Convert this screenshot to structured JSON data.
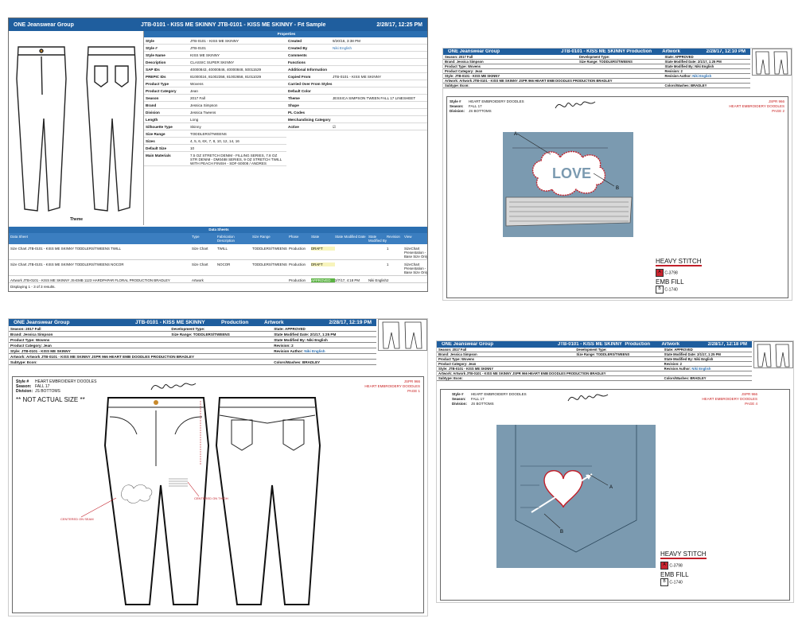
{
  "colors": {
    "header": "#1f5e9e",
    "swatch_a": "#c9252f",
    "denim": "#7b9ab0",
    "stitch": "#c2202a"
  },
  "p1": {
    "title_left": "ONE Jeanswear Group",
    "title_mid": "JTB-0101 - KISS ME SKINNY  JTB-0101 - KISS ME SKINNY - Fit Sample -",
    "title_right": "2/28/17, 12:25 PM",
    "image_caption": "Theme",
    "props_title": "Properties",
    "left": [
      {
        "k": "Style",
        "v": "JTB-0101 - KISS ME SKINNY"
      },
      {
        "k": "Style #",
        "v": "JTB-0101"
      },
      {
        "k": "Style Name",
        "v": "KISS ME SKINNY"
      },
      {
        "k": "Description",
        "v": "CLASSIC SUPER SKINNY"
      },
      {
        "k": "SAP IDs",
        "v": "40000843, 40000846, 40000848, 50011529"
      },
      {
        "k": "PREPIC IDs",
        "v": "81000024, 81002358, 81002658, 81011029"
      },
      {
        "k": "Product Type",
        "v": "Wovens"
      },
      {
        "k": "Product Category",
        "v": "Jean"
      },
      {
        "k": "Season",
        "v": "2017 Fall"
      },
      {
        "k": "Brand",
        "v": "Jessica Simpson"
      },
      {
        "k": "Division",
        "v": "Jessica Tweens"
      },
      {
        "k": "Length",
        "v": "Long"
      },
      {
        "k": "Silhouette Type",
        "v": "Skinny"
      },
      {
        "k": "Size Range",
        "v": "TODDLERS/TWEENS"
      },
      {
        "k": "Sizes",
        "v": "4, 5, 6, 6X, 7, 8, 10, 12, 14, 16"
      },
      {
        "k": "Default Size",
        "v": "10"
      },
      {
        "k": "Main Materials",
        "v": "7.5 OZ STRETCH DENIM - FILLING SERIES, 7.8 OZ STR DENIM - DM0488 SERIES, 9 OZ STRETCH TWILL WITH PEACH FINISH - SDF-S0008 / ANDRES"
      }
    ],
    "right": [
      {
        "k": "Created",
        "v": "9/20/16, 3:38 PM"
      },
      {
        "k": "Created By",
        "v": "Niki English"
      },
      {
        "k": "Comments",
        "v": ""
      },
      {
        "k": "Functions",
        "v": ""
      },
      {
        "k": "Additional Information",
        "v": ""
      },
      {
        "k": "Copied From",
        "v": "JTB-0101 - KISS ME SKINNY"
      },
      {
        "k": "Carried Over From Styles",
        "v": ""
      },
      {
        "k": "Default Color",
        "v": ""
      },
      {
        "k": "Theme",
        "v": "JESSICA SIMPSON TWEEN FALL 17 LINESHEET"
      },
      {
        "k": "Shape",
        "v": ""
      },
      {
        "k": "PL Codes",
        "v": ""
      },
      {
        "k": "Merchandising Category",
        "v": ""
      },
      {
        "k": "Active",
        "v": "☑"
      }
    ],
    "de_title": "Data Sheets",
    "de_headers": [
      "Data Sheet",
      "Type",
      "Fabrication Description",
      "Size Range",
      "Phase",
      "State",
      "State Modified Date",
      "State Modified By",
      "Revision",
      "View"
    ],
    "de_rows": [
      [
        "Size Chart JTB-0101 - KISS ME SKINNY TODDLERS/TWEENS TWILL",
        "Size Chart",
        "TWILL",
        "TODDLERS/TWEENS",
        "Production",
        "DRAFT",
        "",
        "",
        "1",
        "SizeChart Presentation - Base Size Only"
      ],
      [
        "Size Chart JTB-0101 - KISS ME SKINNY TODDLERS/TWEENS NOCOR",
        "Size Chart",
        "NOCOR",
        "TODDLERS/TWEENS",
        "Production",
        "DRAFT",
        "",
        "",
        "1",
        "SizeChart Presentation - Base Size Only"
      ],
      [
        "Artwork JTB-0101 - KISS ME SKINNY JS-EMB 1123 HARDPAPAR FLORAL PRODUCTION BRADLEY",
        "Artwork",
        "",
        "",
        "Production",
        "APPROVED",
        "2/7/17, 4:18 PM",
        "Niki English",
        "2",
        ""
      ]
    ],
    "footer": "Displaying 1 - 3 of 3 results."
  },
  "artwork": {
    "company": "ONE Jeanswear Group",
    "style": "JTB-0101 - KISS ME SKINNY",
    "phase": "Production",
    "tab": "Artwork",
    "season": "Season: 2017 Fall",
    "brand": "Brand: Jessica Simpson",
    "ptype": "Product Type: Wovens",
    "pcat": "Product Category: Jean",
    "style_row": "Style: JTB-0101 - KISS ME SKINNY",
    "art_row": "Artwork: Artwork JTB-0101 - KISS ME SKINNY JSPR 966 HEART EMB DOODLES PRODUCTION BRADLEY",
    "subtype": "Subtype: Econ:",
    "devtype": "Development Type:",
    "sizerange": "Size Range: TODDLERS/TWEENS",
    "state": "State: APPROVED",
    "state_mod": "State Modified Date: 2/1/17, 1:25 PM",
    "mod_by": "State Modified By: Niki English",
    "revision": "Revision: 2",
    "rev_author": "Revision Author:",
    "rev_author_name": "Niki English",
    "colors": "Colors/Washes: BRADLEY",
    "style_num_label": "Style #",
    "style_num": "HEART EMBROIDERY DOODLES",
    "season_label": "Season:",
    "season_val": "FALL 17",
    "division_label": "Division:",
    "division_val": "JS BOTTOMS",
    "jspr": "JSPR 966",
    "jspr_title": "HEART EMBROIDERY DOODLES",
    "love": "LOVE",
    "label_a": "A",
    "label_b": "B",
    "heavy": "HEAVY STITCH",
    "emb": "EMB FILL",
    "code_a": "C-3798",
    "code_b": "C-1740",
    "not_actual": "** NOT ACTUAL SIZE **",
    "callout_left": "CENTERED ON SEAM",
    "callout_right": "CENTERED ON THIGH",
    "signature": "Jessica Simpson"
  },
  "p2": {
    "time": "2/28/17, 12:10 PM",
    "page": "PAGE 2"
  },
  "p3": {
    "time": "2/28/17, 12:19 PM",
    "page": "PAGE 1"
  },
  "p4": {
    "time": "2/28/17, 12:18 PM",
    "page": "PAGE 4"
  }
}
